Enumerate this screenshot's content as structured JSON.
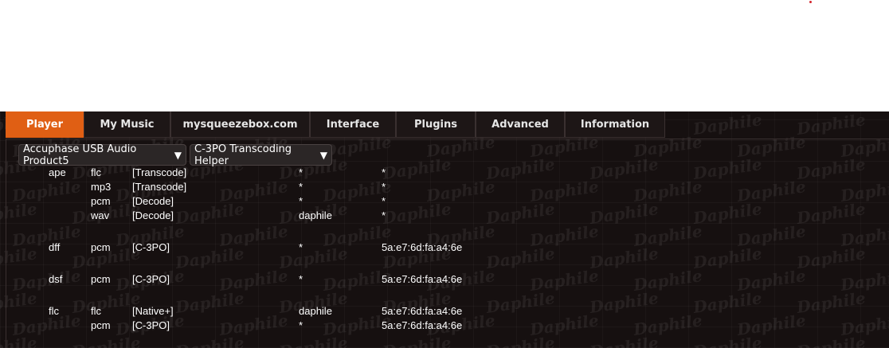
{
  "nav": {
    "tabs": [
      {
        "label": "Player",
        "active": true
      },
      {
        "label": "My Music"
      },
      {
        "label": "mysqueezebox.com"
      },
      {
        "label": "Interface"
      },
      {
        "label": "Plugins"
      },
      {
        "label": "Advanced"
      },
      {
        "label": "Information"
      }
    ]
  },
  "selects": {
    "player": "Accuphase USB Audio Product5",
    "plugin": "C-3PO Transcoding Helper"
  },
  "watermark": "Daphile",
  "rows": [
    {
      "type": "ape",
      "out": "flc",
      "mode": "[Transcode]",
      "host": "*",
      "mac": "*"
    },
    {
      "type": "",
      "out": "mp3",
      "mode": "[Transcode]",
      "host": "*",
      "mac": "*"
    },
    {
      "type": "",
      "out": "pcm",
      "mode": "[Decode]",
      "host": "*",
      "mac": "*"
    },
    {
      "type": "",
      "out": "wav",
      "mode": "[Decode]",
      "host": "daphile",
      "mac": "*"
    },
    {
      "type": "dff",
      "out": "pcm",
      "mode": "[C-3PO]",
      "host": "*",
      "mac": "5a:e7:6d:fa:a4:6e"
    },
    {
      "type": "dsf",
      "out": "pcm",
      "mode": "[C-3PO]",
      "host": "*",
      "mac": "5a:e7:6d:fa:a4:6e"
    },
    {
      "type": "flc",
      "out": "flc",
      "mode": "[Native+]",
      "host": "daphile",
      "mac": "5a:e7:6d:fa:a4:6e"
    },
    {
      "type": "",
      "out": "pcm",
      "mode": "[C-3PO]",
      "host": "*",
      "mac": "5a:e7:6d:fa:a4:6e"
    }
  ],
  "colors": {
    "accent": "#e05f14",
    "background": "#161010"
  }
}
